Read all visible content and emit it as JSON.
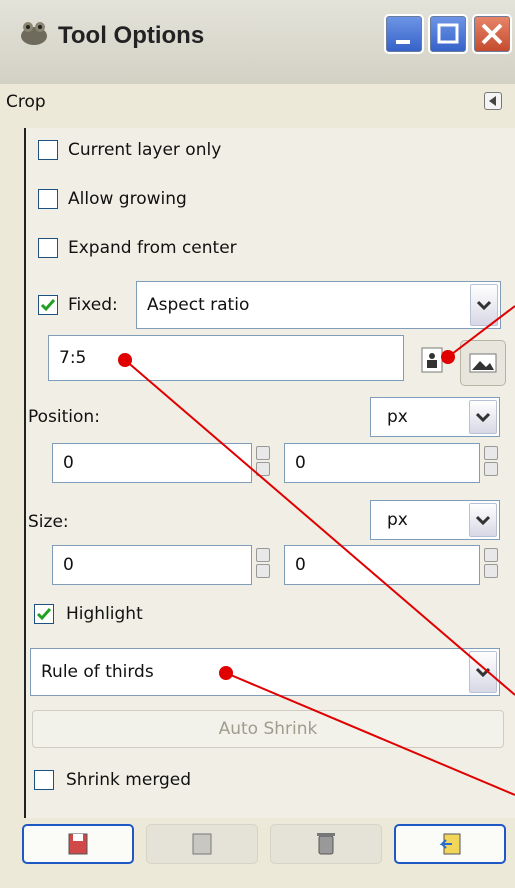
{
  "window": {
    "title": "Tool Options"
  },
  "panel": {
    "title": "Crop"
  },
  "options": {
    "current_layer_only": {
      "label": "Current layer only",
      "checked": false
    },
    "allow_growing": {
      "label": "Allow growing",
      "checked": false
    },
    "expand_from_center": {
      "label": "Expand from center",
      "checked": false
    },
    "fixed": {
      "label": "Fixed:",
      "checked": true,
      "mode": "Aspect ratio"
    },
    "ratio_value": "7:5",
    "position": {
      "label": "Position:",
      "unit": "px",
      "x": "0",
      "y": "0"
    },
    "size": {
      "label": "Size:",
      "unit": "px",
      "w": "0",
      "h": "0"
    },
    "highlight": {
      "label": "Highlight",
      "checked": true
    },
    "guides": "Rule of thirds",
    "auto_shrink_label": "Auto Shrink",
    "shrink_merged": {
      "label": "Shrink merged",
      "checked": false
    }
  },
  "colors": {
    "annotation": "#E00000",
    "accent_blue": "#1F58C5"
  }
}
